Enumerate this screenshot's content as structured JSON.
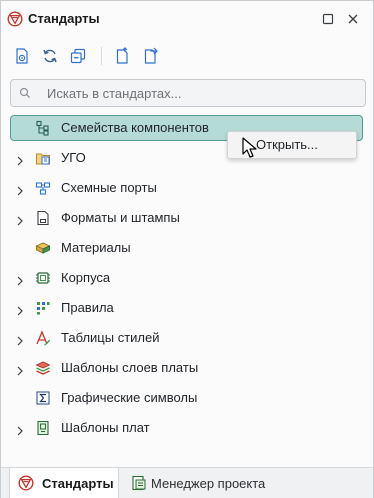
{
  "panel": {
    "title": "Стандарты",
    "title_icon": "standards-logo-icon",
    "window_buttons": [
      "maximize-icon",
      "close-icon"
    ]
  },
  "toolbar": {
    "buttons": [
      "view-standard-icon",
      "refresh-icon",
      "collapse-all-icon",
      "export-icon",
      "import-icon"
    ]
  },
  "search": {
    "placeholder": "Искать в стандартах..."
  },
  "tree": {
    "items": [
      {
        "label": "Семейства компонентов",
        "icon": "component-families-icon",
        "expandable": false,
        "selected": true
      },
      {
        "label": "УГО",
        "icon": "ugo-folder-icon",
        "expandable": true
      },
      {
        "label": "Схемные порты",
        "icon": "schematic-ports-icon",
        "expandable": true
      },
      {
        "label": "Форматы и штампы",
        "icon": "formats-stamps-icon",
        "expandable": true
      },
      {
        "label": "Материалы",
        "icon": "materials-icon",
        "expandable": false
      },
      {
        "label": "Корпуса",
        "icon": "packages-icon",
        "expandable": true
      },
      {
        "label": "Правила",
        "icon": "rules-icon",
        "expandable": true
      },
      {
        "label": "Таблицы стилей",
        "icon": "style-tables-icon",
        "expandable": true
      },
      {
        "label": "Шаблоны слоев платы",
        "icon": "board-layer-templates-icon",
        "expandable": true
      },
      {
        "label": "Графические символы",
        "icon": "graphic-symbols-icon",
        "expandable": false
      },
      {
        "label": "Шаблоны плат",
        "icon": "board-templates-icon",
        "expandable": true
      }
    ]
  },
  "context_menu": {
    "items": [
      {
        "label": "Открыть..."
      }
    ]
  },
  "bottom_tabs": [
    {
      "label": "Стандарты",
      "icon": "standards-logo-icon",
      "active": true
    },
    {
      "label": "Менеджер проекта",
      "icon": "project-manager-icon",
      "active": false
    }
  ],
  "colors": {
    "selection_bg": "#b5dbd6",
    "selection_border": "#4f9e94",
    "accent_red": "#c9332b",
    "accent_green": "#3d9a4a",
    "accent_blue": "#2f6fd6"
  }
}
